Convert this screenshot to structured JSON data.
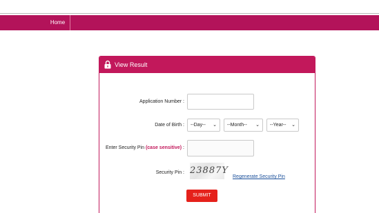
{
  "nav": {
    "home_label": "Home"
  },
  "panel": {
    "title": "View Result"
  },
  "form": {
    "application_number_label": "Application Number :",
    "application_number_value": "",
    "dob_label": "Date of Birth :",
    "dob_day": "--Day--",
    "dob_month": "--Month--",
    "dob_year": "--Year--",
    "security_pin_entry_label_prefix": "Enter Security Pin ",
    "security_pin_entry_label_emphasis": "(case sensitive)",
    "security_pin_entry_label_suffix": " :",
    "security_pin_value": "",
    "security_pin_label": "Security Pin :",
    "captcha_text": "23887Y",
    "regenerate_label": "Regenerate Security Pin",
    "submit_label": "SUBMIT"
  },
  "colors": {
    "brand": "#c2185b",
    "submit": "#e5211b",
    "link": "#1a4f9a"
  },
  "icons": {
    "panel_icon": "lock-icon",
    "select_icon": "chevron-down-icon"
  }
}
